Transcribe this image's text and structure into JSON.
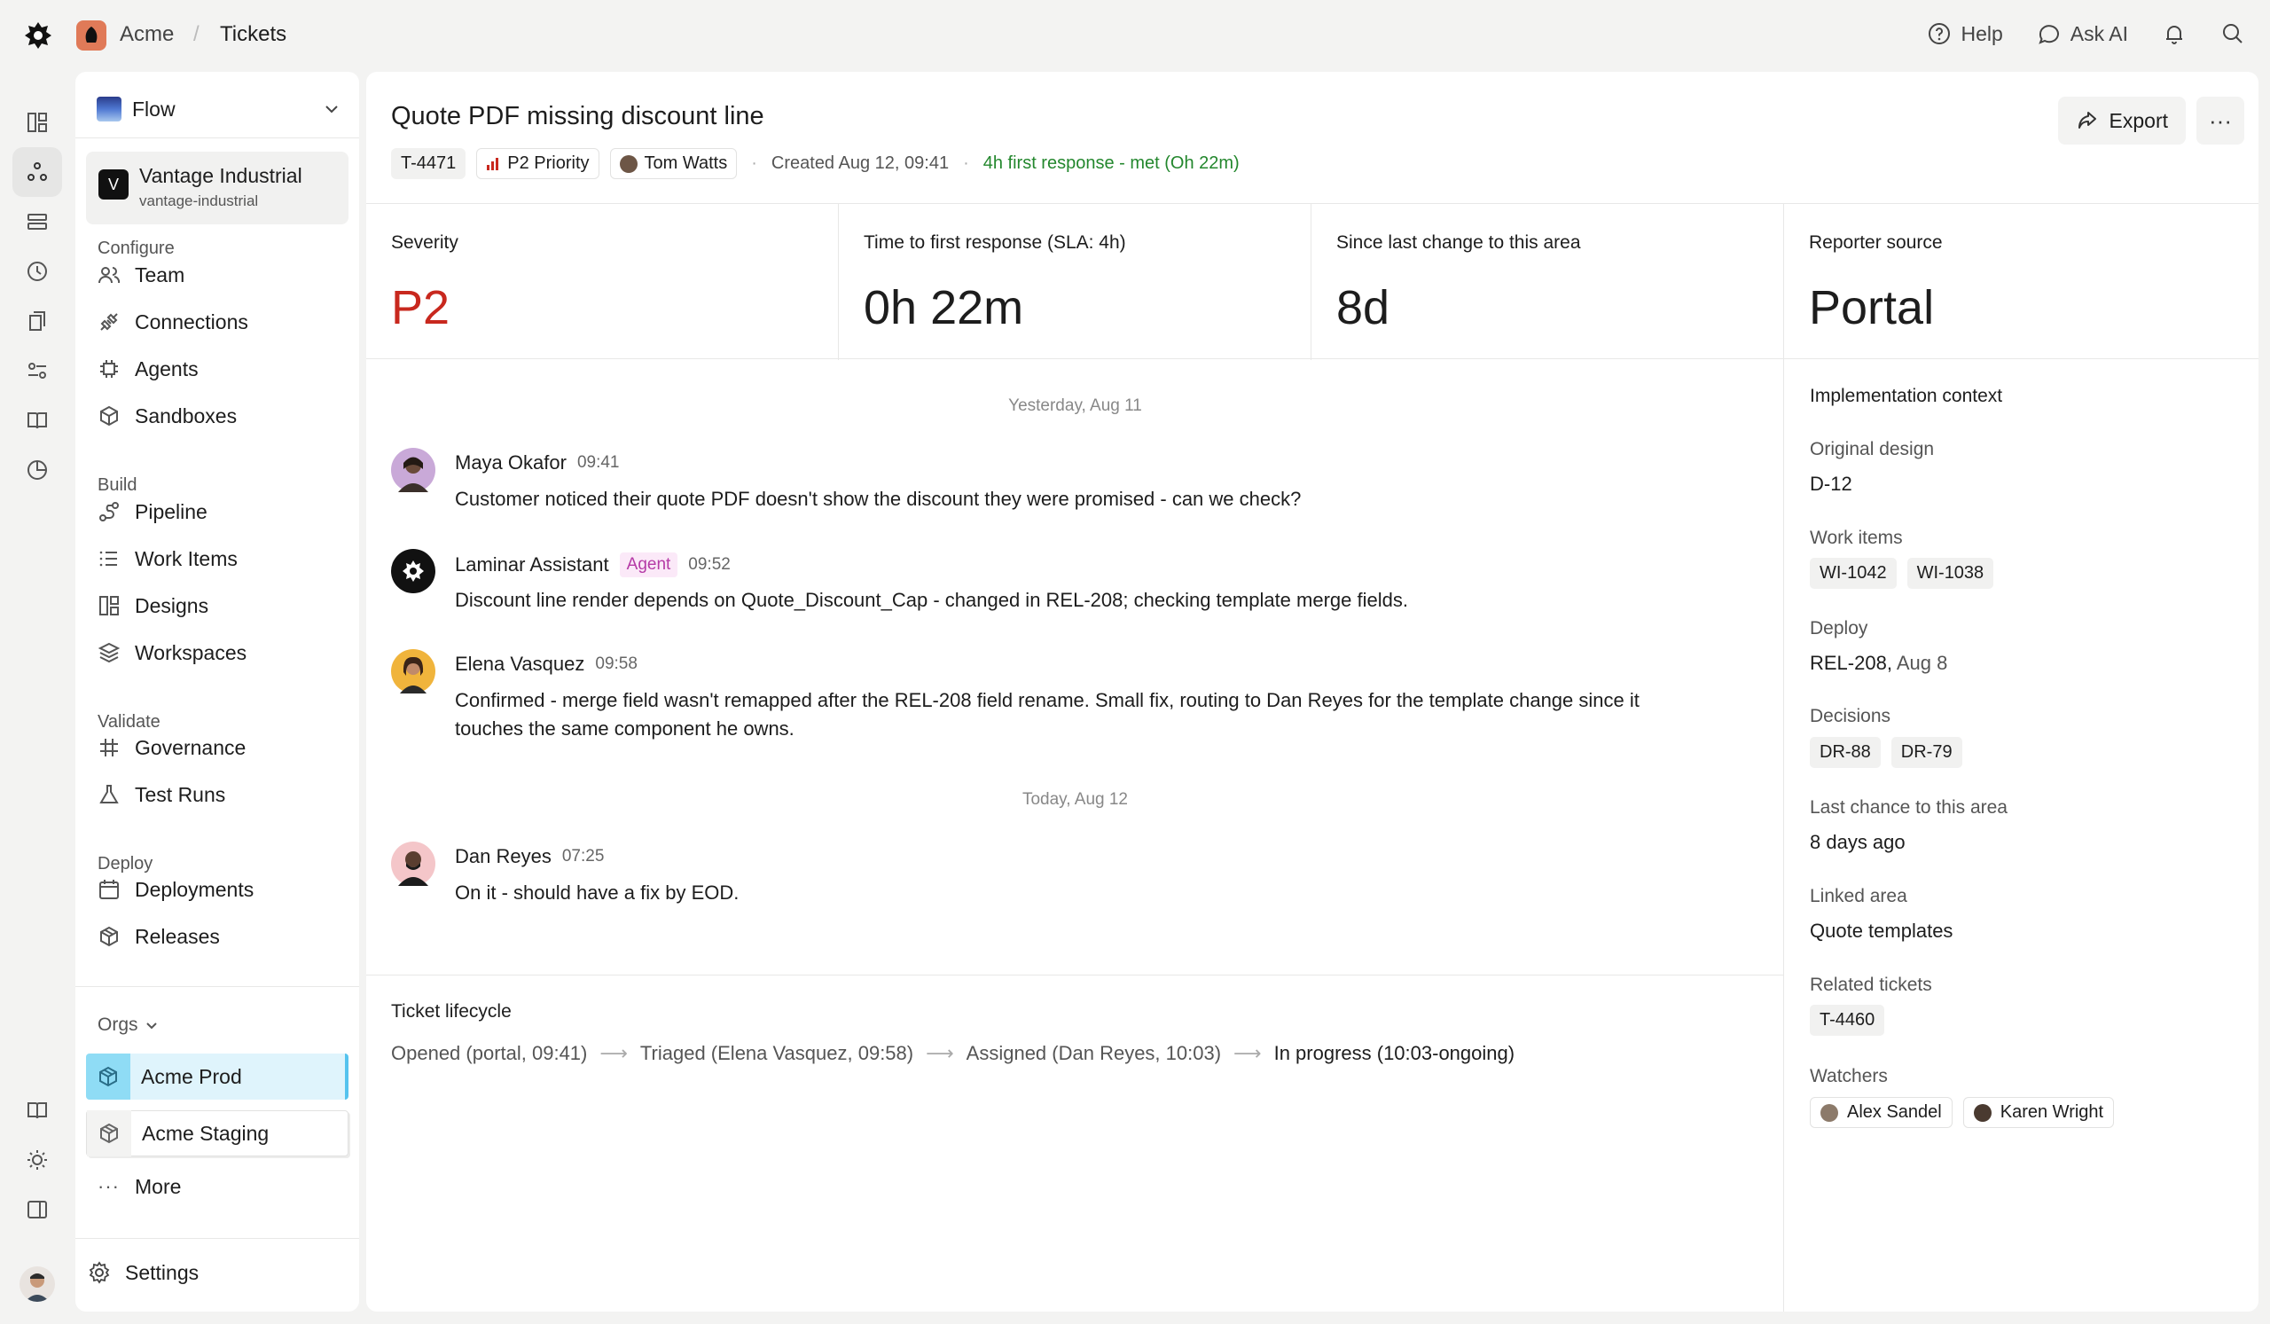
{
  "breadcrumb": {
    "org": "Acme",
    "separator": "/",
    "page": "Tickets"
  },
  "top_actions": {
    "help": "Help",
    "ask_ai": "Ask AI"
  },
  "sidebar": {
    "flow_selector": "Flow",
    "project": {
      "badge": "V",
      "name": "Vantage Industrial",
      "slug": "vantage-industrial"
    },
    "sections": {
      "configure": "Configure",
      "build": "Build",
      "validate": "Validate",
      "deploy": "Deploy"
    },
    "items": {
      "team": "Team",
      "connections": "Connections",
      "agents": "Agents",
      "sandboxes": "Sandboxes",
      "pipeline": "Pipeline",
      "work_items": "Work Items",
      "designs": "Designs",
      "workspaces": "Workspaces",
      "governance": "Governance",
      "test_runs": "Test Runs",
      "deployments": "Deployments",
      "releases": "Releases"
    },
    "orgs_label": "Orgs",
    "orgs": [
      "Acme Prod",
      "Acme Staging"
    ],
    "more": "More",
    "settings": "Settings"
  },
  "ticket": {
    "title": "Quote PDF missing discount line",
    "id": "T-4471",
    "priority": "P2 Priority",
    "assignee": "Tom Watts",
    "created": "Created Aug 12, 09:41",
    "sla_status": "4h first response - met (Oh 22m)",
    "export_label": "Export",
    "more_label": "···"
  },
  "stats": [
    {
      "label": "Severity",
      "value": "P2",
      "accent": "#c8281e"
    },
    {
      "label": "Time to first response (SLA: 4h)",
      "value": "0h 22m"
    },
    {
      "label": "Since last change to this area",
      "value": "8d"
    },
    {
      "label": "Reporter source",
      "value": "Portal"
    }
  ],
  "conversation": {
    "day1": "Yesterday, Aug 11",
    "day2": "Today, Aug 12",
    "messages": [
      {
        "name": "Maya Okafor",
        "time": "09:41",
        "text": "Customer noticed their quote PDF doesn't show the discount they were promised - can we check?"
      },
      {
        "name": "Laminar Assistant",
        "tag": "Agent",
        "time": "09:52",
        "text": "Discount line render depends on Quote_Discount_Cap - changed in REL-208; checking template merge fields."
      },
      {
        "name": "Elena Vasquez",
        "time": "09:58",
        "text": "Confirmed - merge field wasn't remapped after the REL-208 field rename. Small fix, routing to Dan Reyes for the template change since it touches the same component he owns."
      },
      {
        "name": "Dan Reyes",
        "time": "07:25",
        "text": "On it - should have a fix by EOD."
      }
    ]
  },
  "lifecycle": {
    "title": "Ticket lifecycle",
    "steps": [
      "Opened (portal, 09:41)",
      "Triaged (Elena Vasquez, 09:58)",
      "Assigned (Dan Reyes, 10:03)",
      "In progress (10:03-ongoing)"
    ]
  },
  "context": {
    "heading": "Implementation context",
    "original_design_label": "Original design",
    "original_design": "D-12",
    "work_items_label": "Work items",
    "work_items": [
      "WI-1042",
      "WI-1038"
    ],
    "deploy_label": "Deploy",
    "deploy_release": "REL-208,",
    "deploy_date": "Aug 8",
    "decisions_label": "Decisions",
    "decisions": [
      "DR-88",
      "DR-79"
    ],
    "last_change_label": "Last chance to this area",
    "last_change": "8 days ago",
    "linked_area_label": "Linked area",
    "linked_area": "Quote templates",
    "related_label": "Related tickets",
    "related": [
      "T-4460"
    ],
    "watchers_label": "Watchers",
    "watchers": [
      "Alex Sandel",
      "Karen Wright"
    ]
  },
  "colors": {
    "accent_red": "#c8281e",
    "sla_green": "#23872d",
    "agent_tag": "#b53aa6",
    "org_selected": "#dff4fc"
  }
}
